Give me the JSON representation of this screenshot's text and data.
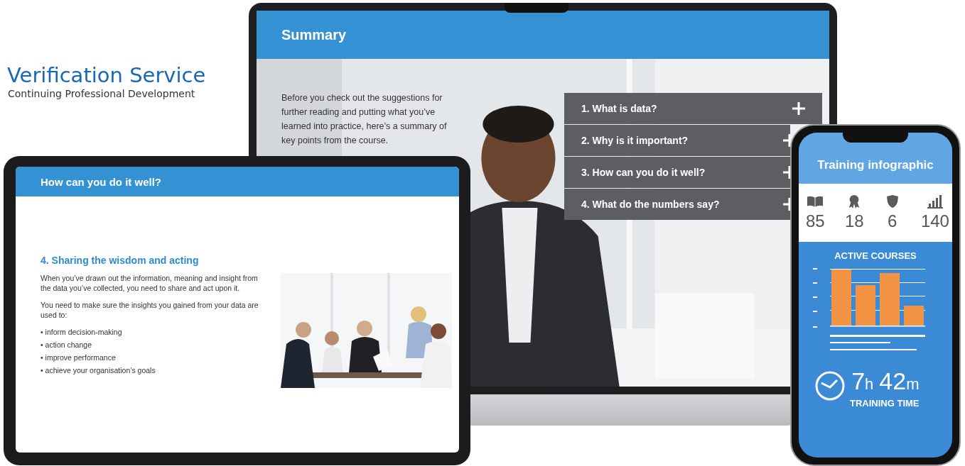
{
  "logo": {
    "title": "Verification Service",
    "subtitle": "Continuing Professional Development"
  },
  "laptop": {
    "header": "Summary",
    "intro": "Before you check out the suggestions for further reading and putting what you’ve learned into practice, here’s a summary of key points from the course.",
    "accordion": [
      {
        "label": "1. What is data?",
        "expanded": false
      },
      {
        "label": "2. Why is it important?",
        "expanded": false
      },
      {
        "label": "3. How can you do it well?",
        "expanded": false
      },
      {
        "label": "4. What do the numbers say?",
        "expanded": false
      }
    ]
  },
  "tablet": {
    "header": "How can you do it well?",
    "heading": "4. Sharing the wisdom and acting",
    "paragraphs": [
      "When you’ve drawn out the information, meaning and insight from the data you’ve collected, you need to share and act upon it.",
      "You need to make sure the insights you gained from your data are used to:"
    ],
    "bullets": [
      "• inform decision-making",
      "•  action change",
      "• improve performance",
      "• achieve your organisation’s goals"
    ]
  },
  "phone": {
    "title": "Training infographic",
    "stats": [
      {
        "kind": "book",
        "value": "85"
      },
      {
        "kind": "award",
        "value": "18"
      },
      {
        "kind": "shield",
        "value": "6"
      },
      {
        "kind": "signal",
        "value": "140"
      }
    ],
    "chart_title": "ACTIVE COURSES",
    "time": {
      "hours": "7",
      "hours_unit": "h",
      "minutes": "42",
      "minutes_unit": "m",
      "label": "TRAINING TIME"
    }
  }
}
